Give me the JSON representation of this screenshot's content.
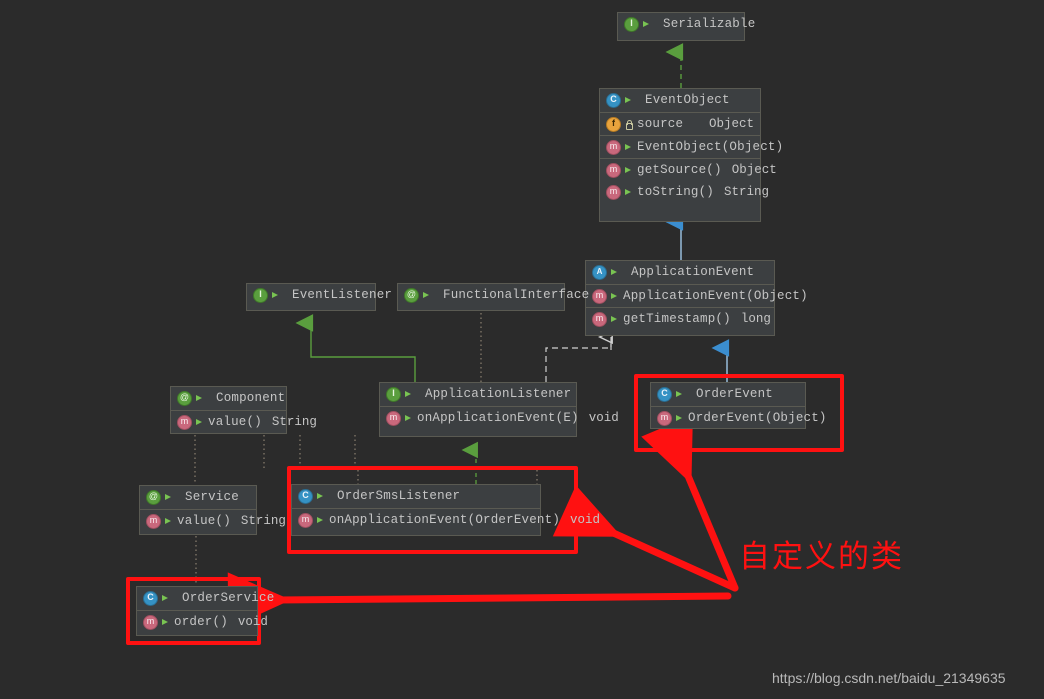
{
  "diagram": {
    "title": "Spring Event UML Class Diagram",
    "background_color": "#2b2b2b",
    "highlight_color": "#ff1111",
    "node_fill": "#3c3f41",
    "node_border": "#5a5a52",
    "text_color": "#c5c5c5"
  },
  "nodes": {
    "serializable": {
      "name": "Serializable",
      "kind": "interface",
      "icon": "interface-icon",
      "visibility": "public",
      "members": []
    },
    "event_object": {
      "name": "EventObject",
      "kind": "class",
      "icon": "class-icon",
      "visibility": "public",
      "members": [
        {
          "icon": "field-icon",
          "visibility": "protected",
          "label": "source",
          "type": "Object",
          "separator": true
        },
        {
          "icon": "method-icon",
          "visibility": "public",
          "label": "EventObject(Object)",
          "type": "",
          "separator": true
        },
        {
          "icon": "method-icon",
          "visibility": "public",
          "label": "getSource()",
          "type": "Object",
          "separator": true
        },
        {
          "icon": "method-icon",
          "visibility": "public",
          "label": "toString()",
          "type": "String",
          "separator": false
        }
      ]
    },
    "application_event": {
      "name": "ApplicationEvent",
      "kind": "abstract-class",
      "icon": "abstract-class-icon",
      "visibility": "public",
      "members": [
        {
          "icon": "method-icon",
          "visibility": "public",
          "label": "ApplicationEvent(Object)",
          "type": "",
          "separator": true
        },
        {
          "icon": "method-icon",
          "visibility": "public",
          "label": "getTimestamp()",
          "type": "long",
          "separator": true
        }
      ]
    },
    "order_event": {
      "name": "OrderEvent",
      "kind": "class",
      "icon": "class-icon",
      "visibility": "public",
      "members": [
        {
          "icon": "method-icon",
          "visibility": "public",
          "label": "OrderEvent(Object)",
          "type": "",
          "separator": true
        }
      ]
    },
    "event_listener": {
      "name": "EventListener",
      "kind": "interface",
      "icon": "interface-icon",
      "visibility": "public",
      "members": []
    },
    "functional_interface": {
      "name": "FunctionalInterface",
      "kind": "annotation",
      "icon": "annotation-icon",
      "visibility": "public",
      "members": []
    },
    "component": {
      "name": "Component",
      "kind": "annotation",
      "icon": "annotation-icon",
      "visibility": "public",
      "members": [
        {
          "icon": "method-icon",
          "visibility": "public",
          "label": "value()",
          "type": "String",
          "separator": true
        }
      ]
    },
    "application_listener": {
      "name": "ApplicationListener",
      "kind": "interface",
      "icon": "interface-icon",
      "visibility": "public",
      "members": [
        {
          "icon": "method-icon",
          "visibility": "public",
          "label": "onApplicationEvent(E)",
          "type": "void",
          "separator": true
        }
      ]
    },
    "service": {
      "name": "Service",
      "kind": "annotation",
      "icon": "annotation-icon",
      "visibility": "public",
      "members": [
        {
          "icon": "method-icon",
          "visibility": "public",
          "label": "value()",
          "type": "String",
          "separator": true
        }
      ]
    },
    "order_sms_listener": {
      "name": "OrderSmsListener",
      "kind": "class",
      "icon": "class-icon",
      "visibility": "public",
      "members": [
        {
          "icon": "method-icon",
          "visibility": "public",
          "label": "onApplicationEvent(OrderEvent)",
          "type": "void",
          "separator": true
        }
      ]
    },
    "order_service": {
      "name": "OrderService",
      "kind": "class",
      "icon": "class-icon",
      "visibility": "public",
      "members": [
        {
          "icon": "method-icon",
          "visibility": "public",
          "label": "order()",
          "type": "void",
          "separator": true
        }
      ]
    }
  },
  "annotations": {
    "custom_classes_label": "自定义的类",
    "watermark": "https://blog.csdn.net/baidu_21349635"
  },
  "edges": [
    {
      "from": "event_object",
      "to": "serializable",
      "style": "dashed",
      "arrow": "hollow-triangle",
      "color": "#5a9e3e"
    },
    {
      "from": "application_event",
      "to": "event_object",
      "style": "solid",
      "arrow": "filled-triangle",
      "color": "#3b8ed0"
    },
    {
      "from": "order_event",
      "to": "application_event",
      "style": "solid",
      "arrow": "filled-triangle",
      "color": "#3b8ed0"
    },
    {
      "from": "application_listener",
      "to": "event_listener",
      "style": "solid",
      "arrow": "hollow-triangle",
      "color": "#5a9e3e"
    },
    {
      "from": "application_listener",
      "to": "functional_interface",
      "style": "dotted",
      "arrow": "none",
      "color": "#8a8070"
    },
    {
      "from": "application_listener",
      "to": "application_event",
      "style": "dashed",
      "arrow": "hollow-triangle",
      "color": "#cfcfcf"
    },
    {
      "from": "order_sms_listener",
      "to": "application_listener",
      "style": "dashed",
      "arrow": "hollow-triangle",
      "color": "#5a9e3e"
    },
    {
      "from": "service",
      "to": "component",
      "style": "dotted",
      "arrow": "none",
      "color": "#8a8070"
    },
    {
      "from": "order_service",
      "to": "service",
      "style": "dotted",
      "arrow": "none",
      "color": "#8a8070"
    }
  ]
}
